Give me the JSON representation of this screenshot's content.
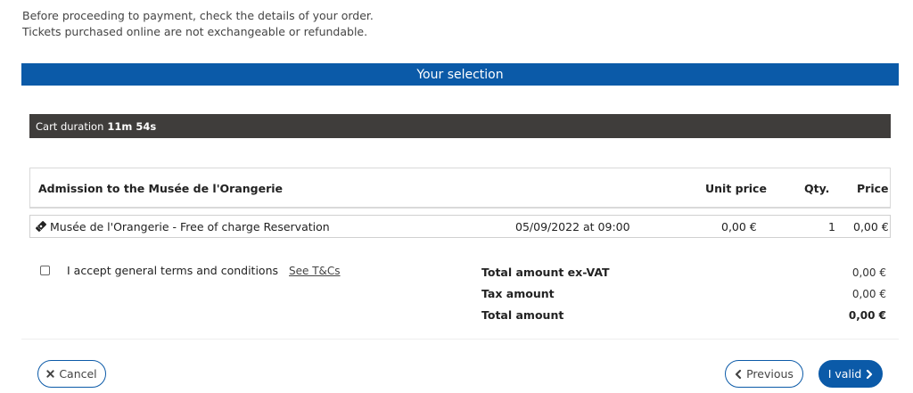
{
  "intro": {
    "line1": "Before proceeding to payment, check the details of your order.",
    "line2": "Tickets purchased online are not exchangeable or refundable."
  },
  "selection": {
    "title": "Your selection"
  },
  "cart": {
    "label": "Cart duration",
    "duration": "11m 54s"
  },
  "table": {
    "headers": {
      "item": "Admission to the Musée de l'Orangerie",
      "unit_price": "Unit price",
      "qty": "Qty.",
      "price": "Price"
    },
    "rows": [
      {
        "icon": "ticket-icon",
        "name": "Musée de l'Orangerie - Free of charge Reservation",
        "datetime": "05/09/2022 at 09:00",
        "unit_price": "0,00 €",
        "qty": "1",
        "price": "0,00 €"
      }
    ]
  },
  "terms": {
    "label": "I accept general terms and conditions",
    "link": "See T&Cs",
    "checked": false
  },
  "totals": {
    "ex_vat_label": "Total amount ex-VAT",
    "ex_vat_value": "0,00 €",
    "tax_label": "Tax amount",
    "tax_value": "0,00 €",
    "total_label": "Total amount",
    "total_value": "0,00 €"
  },
  "buttons": {
    "cancel": "Cancel",
    "previous": "Previous",
    "valid": "I valid"
  },
  "colors": {
    "accent": "#0b5aa8",
    "dark_bar": "#3f3d3b"
  }
}
